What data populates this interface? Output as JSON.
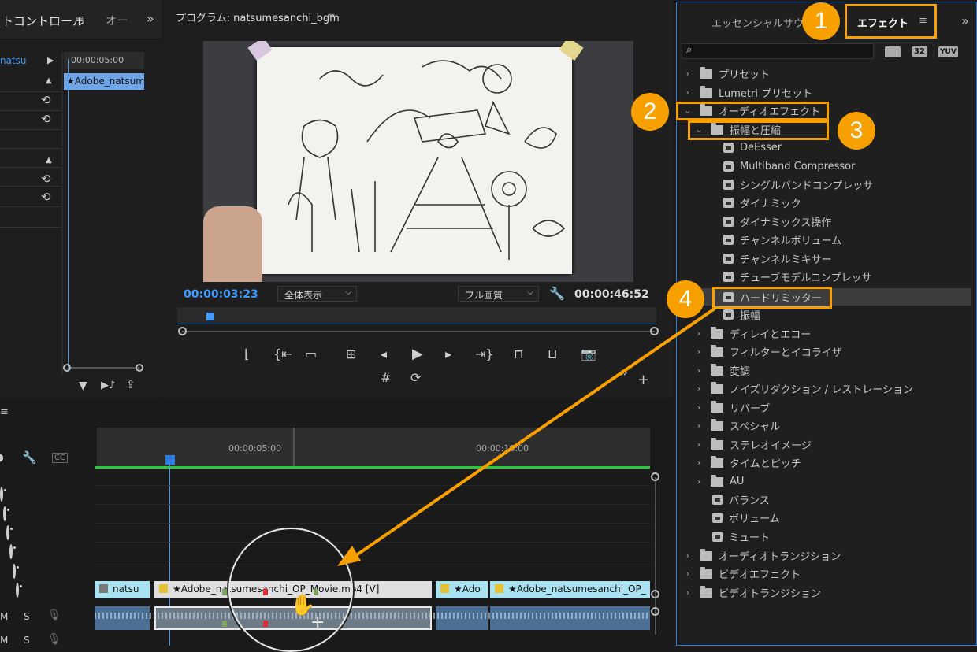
{
  "left_panel": {
    "title": "トコントロール",
    "tab2": "オー",
    "clip_label": "natsu",
    "timecode": "00:00:05:00",
    "clip_name": "★Adobe_natsume"
  },
  "program": {
    "title": "プログラム: natsumesanchi_bgm",
    "current_time": "00:00:03:23",
    "zoom_select": "全体表示",
    "quality_select": "フル画質",
    "duration": "00:00:46:52"
  },
  "timeline": {
    "ruler_5s": "00:00:05:00",
    "ruler_10s": "00:00:10:00",
    "clips_v": [
      {
        "label": "natsu"
      },
      {
        "label": "★Adobe_natsumesanchi_OP_Movie.mp4 [V]"
      },
      {
        "label": "★Ado"
      },
      {
        "label": "★Adobe_natsumesanchi_OP_"
      }
    ],
    "track_m": "M",
    "track_s": "S"
  },
  "effects_panel": {
    "tab_essential": "エッセンシャルサウ",
    "tab_effects": "エフェクト",
    "btn_32": "32",
    "btn_yuv": "YUV",
    "tree": [
      {
        "label": "プリセット"
      },
      {
        "label": "Lumetri プリセット"
      },
      {
        "label": "オーディオエフェクト"
      },
      {
        "label": "振幅と圧縮"
      },
      {
        "label": "DeEsser"
      },
      {
        "label": "Multiband Compressor"
      },
      {
        "label": "シングルバンドコンプレッサ"
      },
      {
        "label": "ダイナミック"
      },
      {
        "label": "ダイナミックス操作"
      },
      {
        "label": "チャンネルボリューム"
      },
      {
        "label": "チャンネルミキサー"
      },
      {
        "label": "チューブモデルコンプレッサ"
      },
      {
        "label": "ハードリミッター"
      },
      {
        "label": "振幅"
      },
      {
        "label": "ディレイとエコー"
      },
      {
        "label": "フィルターとイコライザ"
      },
      {
        "label": "変調"
      },
      {
        "label": "ノイズリダクション / レストレーション"
      },
      {
        "label": "リバーブ"
      },
      {
        "label": "スペシャル"
      },
      {
        "label": "ステレオイメージ"
      },
      {
        "label": "タイムとピッチ"
      },
      {
        "label": "AU"
      },
      {
        "label": "バランス"
      },
      {
        "label": "ボリューム"
      },
      {
        "label": "ミュート"
      },
      {
        "label": "オーディオトランジション"
      },
      {
        "label": "ビデオエフェクト"
      },
      {
        "label": "ビデオトランジション"
      }
    ]
  },
  "annotations": [
    "1",
    "2",
    "3",
    "4"
  ],
  "colors": {
    "accent": "#f7a000",
    "timecode_blue": "#3d9bff",
    "selection": "#2f7ce0"
  }
}
